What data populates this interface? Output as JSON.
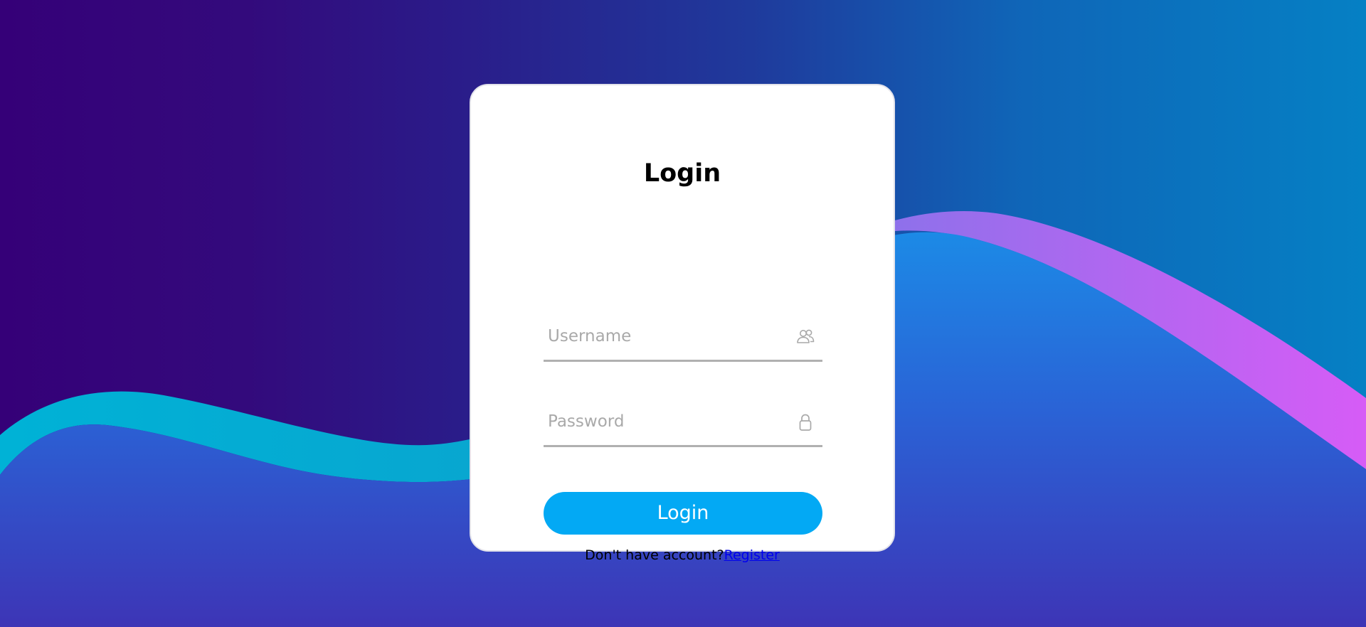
{
  "login_card": {
    "title": "Login",
    "username": {
      "placeholder": "Username",
      "value": "",
      "icon": "user-group-icon"
    },
    "password": {
      "placeholder": "Password",
      "value": "",
      "icon": "lock-icon"
    },
    "submit_label": "Login",
    "register_prompt": "Don't have account?",
    "register_link": "Register"
  },
  "colors": {
    "button": "#03a9f4",
    "link": "#0000ee",
    "wave_left_band": "#00a7d0",
    "wave_right_band": "#d55cf5",
    "wave_fill": "#2e61d8"
  }
}
